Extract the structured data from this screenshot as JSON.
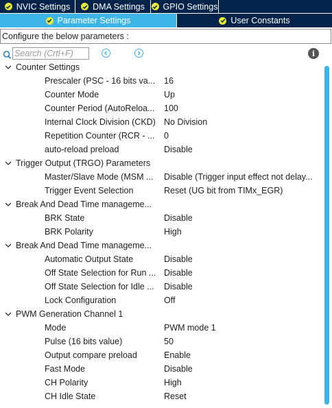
{
  "tabs_row1": [
    {
      "label": "NVIC Settings",
      "icon": "check-circle-icon"
    },
    {
      "label": "DMA Settings",
      "icon": "check-circle-icon"
    },
    {
      "label": "GPIO Settings",
      "icon": "check-circle-icon"
    }
  ],
  "tabs_row2": [
    {
      "label": "Parameter Settings",
      "icon": "check-circle-icon",
      "active": true
    },
    {
      "label": "User Constants",
      "icon": "check-circle-icon",
      "active": false
    }
  ],
  "config_label": "Configure the below parameters :",
  "search": {
    "placeholder": "Search (Crtl+F)"
  },
  "colors": {
    "tab_dark": "#03234b",
    "tab_active": "#3cb4e6",
    "check_badge": "#e8ea3a",
    "scroll_thumb": "#3cb4e6",
    "nav_button": "#3cb4e6"
  },
  "groups": [
    {
      "title": "Counter Settings",
      "params": [
        {
          "name": "Prescaler (PSC - 16 bits va...",
          "value": "16"
        },
        {
          "name": "Counter Mode",
          "value": "Up"
        },
        {
          "name": "Counter Period (AutoReloa...",
          "value": "100"
        },
        {
          "name": "Internal Clock Division (CKD)",
          "value": "No Division"
        },
        {
          "name": "Repetition Counter (RCR - ...",
          "value": "0"
        },
        {
          "name": "auto-reload preload",
          "value": "Disable"
        }
      ]
    },
    {
      "title": "Trigger Output (TRGO) Parameters",
      "params": [
        {
          "name": "Master/Slave Mode (MSM ...",
          "value": "Disable (Trigger input effect not delay..."
        },
        {
          "name": "Trigger Event Selection",
          "value": "Reset (UG bit from TIMx_EGR)"
        }
      ]
    },
    {
      "title": "Break And Dead Time manageme...",
      "params": [
        {
          "name": "BRK State",
          "value": "Disable"
        },
        {
          "name": "BRK Polarity",
          "value": "High"
        }
      ]
    },
    {
      "title": "Break And Dead Time manageme...",
      "params": [
        {
          "name": "Automatic Output State",
          "value": "Disable"
        },
        {
          "name": "Off State Selection for Run ...",
          "value": "Disable"
        },
        {
          "name": "Off State Selection for Idle ...",
          "value": "Disable"
        },
        {
          "name": "Lock Configuration",
          "value": "Off"
        }
      ]
    },
    {
      "title": "PWM Generation Channel 1",
      "params": [
        {
          "name": "Mode",
          "value": "PWM mode 1"
        },
        {
          "name": "Pulse (16 bits value)",
          "value": "50"
        },
        {
          "name": "Output compare preload",
          "value": "Enable"
        },
        {
          "name": "Fast Mode",
          "value": "Disable"
        },
        {
          "name": "CH Polarity",
          "value": "High"
        },
        {
          "name": "CH Idle State",
          "value": "Reset"
        }
      ]
    }
  ]
}
